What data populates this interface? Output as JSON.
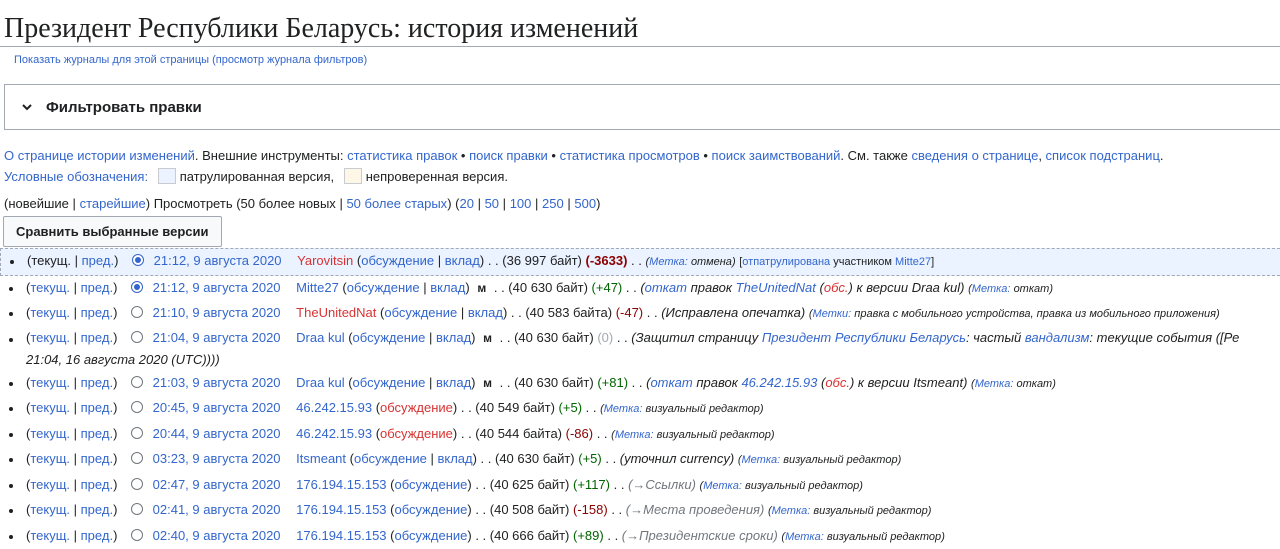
{
  "page": {
    "title": "Президент Республики Беларусь: история изменений",
    "sublink": "Показать журналы для этой страницы (просмотр журнала фильтров)"
  },
  "filter": {
    "label": "Фильтровать правки"
  },
  "info": {
    "about": "О странице истории изменений",
    "external": ". Внешние инструменты:",
    "tool1": "статистика правок",
    "tool2": "поиск правки",
    "tool3": "статистика просмотров",
    "tool4": "поиск заимствований",
    "see_also": ". См. также",
    "pageinfo": "сведения о странице",
    "subpages": "список подстраниц",
    "legend": "Условные обозначения:",
    "patrolled": "патрулированная версия,",
    "unpatrolled": "непроверенная версия."
  },
  "nav": {
    "newest": "(новейшие",
    "sep": "|",
    "oldest": "старейшие",
    "view": ") Просмотреть (50 более новых",
    "older": "50 более старых",
    "open": ") (",
    "n20": "20",
    "n50": "50",
    "n100": "100",
    "n250": "250",
    "n500": "500",
    "close": ")"
  },
  "compare_label": "Сравнить выбранные версии",
  "rows": [
    {
      "cur": "текущ.",
      "prev": "пред.",
      "date": "21:12, 9 августа 2020",
      "user": "Yarovitsin",
      "talk": "обсуждение",
      "contrib": "вклад",
      "size": ". . (36 997 байт)",
      "diff": "(-3633)",
      "tagl": "Метка:",
      "tag": "отмена",
      "patrol_a": "[",
      "patrol_link": "отпатрулирована",
      "patrol_b": "участником",
      "patroller": "Mitte27",
      "patrol_c": "]"
    },
    {
      "cur": "текущ.",
      "prev": "пред.",
      "date": "21:12, 9 августа 2020",
      "user": "Mitte27",
      "talk": "обсуждение",
      "contrib": "вклад",
      "minor": "м",
      "size": ". . (40 630 байт)",
      "diff": "(+47)",
      "c1": "откат",
      "c2": "правок",
      "c3": "TheUnitedNat",
      "c4": "обс.",
      "c5": "к версии Draa kul",
      "tagl": "Метка:",
      "tag": "откат"
    },
    {
      "cur": "текущ.",
      "prev": "пред.",
      "date": "21:10, 9 августа 2020",
      "user": "TheUnitedNat",
      "talk": "обсуждение",
      "contrib": "вклад",
      "size": ". . (40 583 байта)",
      "diff": "(-47)",
      "comment": "(Исправлена опечатка)",
      "tagl": "Метки:",
      "tag": "правка с мобильного устройства, правка из мобильного приложения"
    },
    {
      "cur": "текущ.",
      "prev": "пред.",
      "date": "21:04, 9 августа 2020",
      "user": "Draa kul",
      "talk": "обсуждение",
      "contrib": "вклад",
      "minor": "м",
      "size": ". . (40 630 байт)",
      "diff": "(0)",
      "c1": "(Защитил страницу",
      "c2": "Президент Республики Беларусь",
      "c3": ": частый",
      "c4": "вандализм",
      "c5": ": текущие события ([Ре",
      "c6": "21:04, 16 августа 2020 (UTC))))"
    },
    {
      "cur": "текущ.",
      "prev": "пред.",
      "date": "21:03, 9 августа 2020",
      "user": "Draa kul",
      "talk": "обсуждение",
      "contrib": "вклад",
      "minor": "м",
      "size": ". . (40 630 байт)",
      "diff": "(+81)",
      "c1": "откат",
      "c2": "правок",
      "c3": "46.242.15.93",
      "c4": "обс.",
      "c5": "к версии Itsmeant",
      "tagl": "Метка:",
      "tag": "откат"
    },
    {
      "cur": "текущ.",
      "prev": "пред.",
      "date": "20:45, 9 августа 2020",
      "user": "46.242.15.93",
      "talk": "обсуждение",
      "size": ". . (40 549 байт)",
      "diff": "(+5)",
      "tagl": "Метка:",
      "tag": "визуальный редактор"
    },
    {
      "cur": "текущ.",
      "prev": "пред.",
      "date": "20:44, 9 августа 2020",
      "user": "46.242.15.93",
      "talk": "обсуждение",
      "size": ". . (40 544 байта)",
      "diff": "(-86)",
      "tagl": "Метка:",
      "tag": "визуальный редактор"
    },
    {
      "cur": "текущ.",
      "prev": "пред.",
      "date": "03:23, 9 августа 2020",
      "user": "Itsmeant",
      "talk": "обсуждение",
      "contrib": "вклад",
      "size": ". . (40 630 байт)",
      "diff": "(+5)",
      "comment": "(уточнил currency)",
      "tagl": "Метка:",
      "tag": "визуальный редактор"
    },
    {
      "cur": "текущ.",
      "prev": "пред.",
      "date": "02:47, 9 августа 2020",
      "user": "176.194.15.153",
      "talk": "обсуждение",
      "size": ". . (40 625 байт)",
      "diff": "(+117)",
      "section": "→Ссылки",
      "tagl": "Метка:",
      "tag": "визуальный редактор"
    },
    {
      "cur": "текущ.",
      "prev": "пред.",
      "date": "02:41, 9 августа 2020",
      "user": "176.194.15.153",
      "talk": "обсуждение",
      "size": ". . (40 508 байт)",
      "diff": "(-158)",
      "section": "→Места проведения",
      "tagl": "Метка:",
      "tag": "визуальный редактор"
    },
    {
      "cur": "текущ.",
      "prev": "пред.",
      "date": "02:40, 9 августа 2020",
      "user": "176.194.15.153",
      "talk": "обсуждение",
      "size": ". . (40 666 байт)",
      "diff": "(+89)",
      "section": "→Президентские сроки",
      "tagl": "Метка:",
      "tag": "визуальный редактор"
    }
  ],
  "colors": {
    "link": "#3366cc",
    "redlink": "#d73333",
    "positive": "#006400",
    "negative": "#8b0000",
    "selected_bg": "#eaf3ff"
  }
}
